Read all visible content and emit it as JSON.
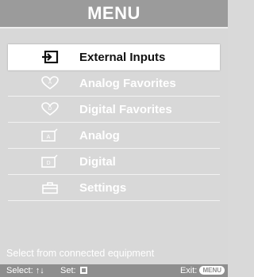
{
  "title": "MENU",
  "menu": {
    "items": [
      {
        "label": "External Inputs",
        "icon": "input-icon",
        "selected": true
      },
      {
        "label": "Analog Favorites",
        "icon": "heart-a-icon",
        "selected": false
      },
      {
        "label": "Digital Favorites",
        "icon": "heart-d-icon",
        "selected": false
      },
      {
        "label": "Analog",
        "icon": "tv-a-icon",
        "selected": false
      },
      {
        "label": "Digital",
        "icon": "tv-d-icon",
        "selected": false
      },
      {
        "label": "Settings",
        "icon": "toolbox-icon",
        "selected": false
      }
    ]
  },
  "hint": "Select from connected equipment",
  "footer": {
    "select_label": "Select:",
    "select_arrows": "↑↓",
    "set_label": "Set:",
    "exit_label": "Exit:",
    "exit_badge": "MENU"
  }
}
